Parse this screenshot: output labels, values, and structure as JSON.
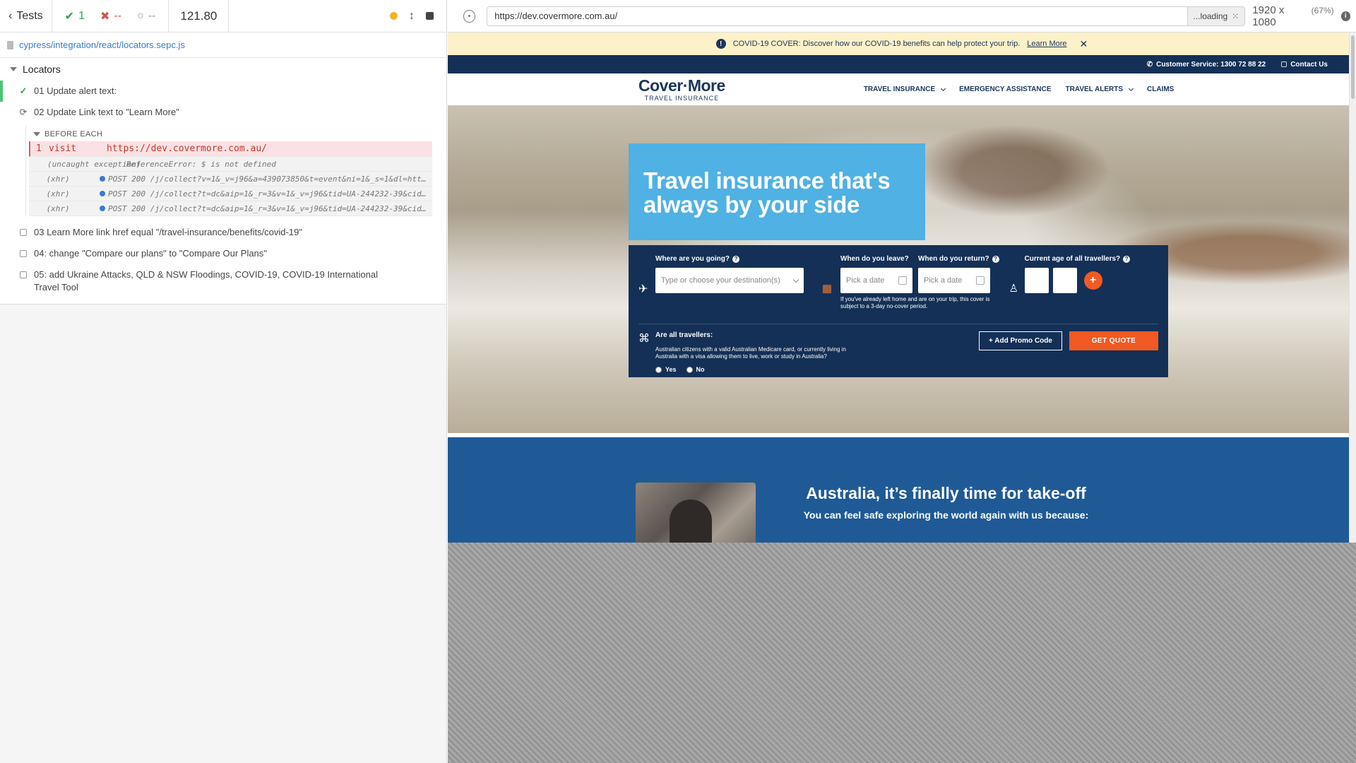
{
  "reporter": {
    "tests_label": "Tests",
    "passed": "1",
    "failed": "--",
    "pending": "--",
    "duration": "121.80",
    "spec_path": "cypress/integration/react/locators.sepc.js",
    "suite_title": "Locators",
    "tests": [
      {
        "title": "01 Update alert text:",
        "state": "passed"
      },
      {
        "title": "02 Update Link text to \"Learn More\"",
        "state": "running"
      },
      {
        "title": "03 Learn More link href equal \"/travel-insurance/benefits/covid-19\"",
        "state": "pending"
      },
      {
        "title": "04: change \"Compare our plans\" to \"Compare Our Plans\"",
        "state": "pending"
      },
      {
        "title": "05: add Ukraine Attacks, QLD & NSW Floodings, COVID-19, COVID-19 International Travel Tool",
        "state": "pending"
      }
    ],
    "hook_title": "BEFORE EACH",
    "commands": [
      {
        "num": "1",
        "name": "visit",
        "message": "https://dev.covermore.com.au/"
      },
      {
        "num": "",
        "name": "(uncaught exception)",
        "message": "ReferenceError: $ is not defined"
      },
      {
        "num": "",
        "name": "(xhr)",
        "message": "POST 200 /j/collect?v=1&_v=j96&a=439073850&t=event&ni=1&_s=1&dl=https:/..."
      },
      {
        "num": "",
        "name": "(xhr)",
        "message": "POST 200 /j/collect?t=dc&aip=1&_r=3&v=1&_v=j96&tid=UA-244232-39&cid=940..."
      },
      {
        "num": "",
        "name": "(xhr)",
        "message": "POST 200 /j/collect?t=dc&aip=1&_r=3&v=1&_v=j96&tid=UA-244232-39&cid=940..."
      }
    ]
  },
  "browser": {
    "url": "https://dev.covermore.com.au/",
    "loading": "...loading",
    "viewport": "1920 x 1080",
    "scale": "(67%)"
  },
  "site": {
    "alert_text": "COVID-19 COVER: Discover how our COVID-19 benefits can help protect your trip.",
    "alert_link": "Learn More",
    "customer_service": "Customer Service: 1300 72 88 22",
    "contact_us": "Contact Us",
    "logo_brand": "Cover·More",
    "logo_sub": "TRAVEL INSURANCE",
    "nav": [
      "TRAVEL INSURANCE",
      "EMERGENCY ASSISTANCE",
      "TRAVEL ALERTS",
      "CLAIMS"
    ],
    "hero_title": "Travel insurance that's always by your side",
    "quote": {
      "where_label": "Where are you going?",
      "where_placeholder": "Type or choose your destination(s)",
      "leave_label": "When do you leave?",
      "return_label": "When do you return?",
      "date_placeholder": "Pick a date",
      "note": "If you've already left home and are on your trip, this cover is subject to a 3-day no-cover period.",
      "age_label": "Current age of all travellers?",
      "all_travellers": "Are all travellers:",
      "citizens": "Australian citizens with a valid Australian Medicare card, or currently living in Australia with a visa allowing them to live, work or study in Australia?",
      "yes": "Yes",
      "no": "No",
      "promo_btn": "+ Add Promo Code",
      "quote_btn": "GET QUOTE"
    },
    "promo_title": "Australia, it’s finally time for take-off",
    "promo_sub": "You can feel safe exploring the world again with us because:"
  },
  "colors": {
    "brand_navy": "#143056",
    "brand_orange": "#f15a22",
    "hero_blue": "#4fb1e4",
    "pass_green": "#2da44e",
    "fail_red": "#d9534f"
  }
}
